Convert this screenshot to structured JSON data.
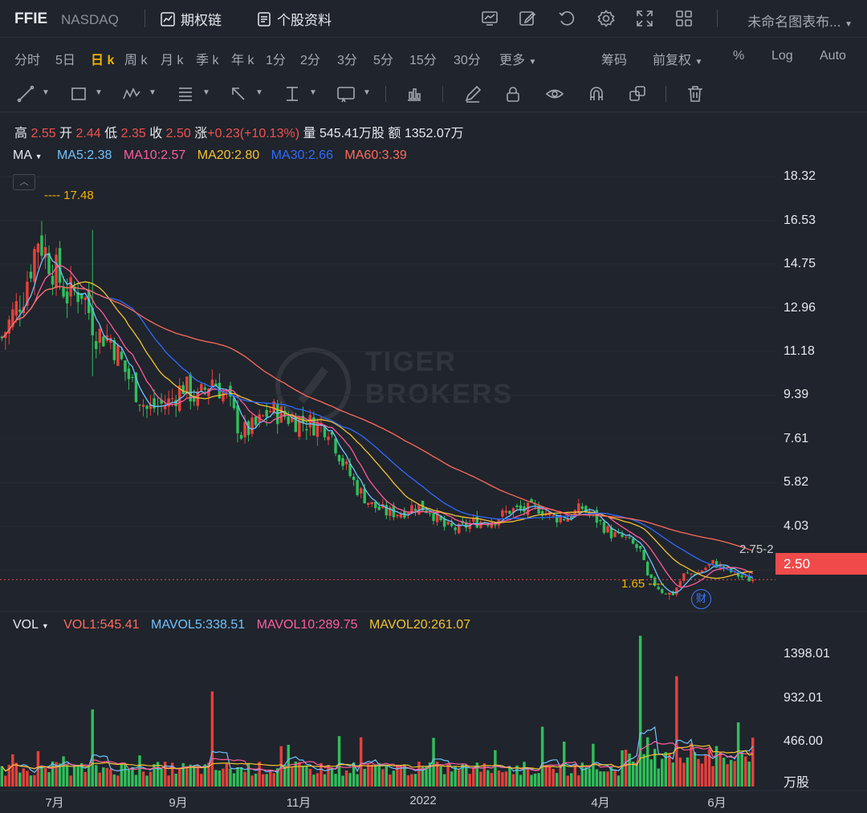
{
  "header": {
    "ticker": "FFIE",
    "exchange": "NASDAQ",
    "options_chain": "期权链",
    "stock_profile": "个股资料",
    "layout_name": "未命名图表布..."
  },
  "periods": [
    "分时",
    "5日",
    "日 k",
    "周 k",
    "月 k",
    "季 k",
    "年 k",
    "1分",
    "2分",
    "3分",
    "5分",
    "15分",
    "30分",
    "更多"
  ],
  "active_period": "日 k",
  "right_options": {
    "chips": "筹码",
    "adjust": "前复权",
    "percent": "%",
    "log": "Log",
    "auto": "Auto"
  },
  "info": {
    "high_label": "高",
    "high": "2.55",
    "open_label": "开",
    "open": "2.44",
    "low_label": "低",
    "low": "2.35",
    "close_label": "收",
    "close": "2.50",
    "change_label": "涨",
    "change": "+0.23(+10.13%)",
    "volume_label": "量",
    "volume": "545.41万股",
    "amount_label": "额",
    "amount": "1352.07万"
  },
  "ma_legend": {
    "name": "MA",
    "items": [
      {
        "text": "MA5:2.38",
        "color": "#6fc3ff"
      },
      {
        "text": "MA10:2.57",
        "color": "#ff5c9d"
      },
      {
        "text": "MA20:2.80",
        "color": "#f2c230"
      },
      {
        "text": "MA30:2.66",
        "color": "#2f6bff"
      },
      {
        "text": "MA60:3.39",
        "color": "#ff6b5c"
      }
    ]
  },
  "vol_legend": {
    "name": "VOL",
    "items": [
      {
        "text": "VOL1:545.41",
        "color": "#ff6b5c"
      },
      {
        "text": "MAVOL5:338.51",
        "color": "#6fc3ff"
      },
      {
        "text": "MAVOL10:289.75",
        "color": "#ff5c9d"
      },
      {
        "text": "MAVOL20:261.07",
        "color": "#f2c230"
      }
    ]
  },
  "annotations": {
    "max_label": "17.48",
    "min_label": "1.65",
    "right_partial": "2.75-2",
    "earnings_icon": "财",
    "last_price": "2.50"
  },
  "watermark": {
    "line1": "TIGER",
    "line2": "BROKERS"
  },
  "chart_data": {
    "type": "candlestick",
    "price_axis": {
      "ticks": [
        "18.32",
        "16.53",
        "14.75",
        "12.96",
        "11.18",
        "9.39",
        "7.61",
        "5.82",
        "4.03",
        "2.50"
      ],
      "min": 1.3,
      "max": 19.5
    },
    "volume_axis": {
      "ticks": [
        "1398.01",
        "932.01",
        "466.00"
      ],
      "unit": "万股"
    },
    "x_ticks": [
      "7月",
      "9月",
      "11月",
      "2022",
      "4月",
      "6月"
    ],
    "colors": {
      "up": "#e8403c",
      "down": "#2fbf5a",
      "ma5": "#6fc3ff",
      "ma10": "#ff5c9d",
      "ma20": "#f2c230",
      "ma30": "#2f6bff",
      "ma60": "#ff6b5c"
    },
    "close_trend": [
      [
        0,
        12.6
      ],
      [
        6,
        14.5
      ],
      [
        10,
        16.8
      ],
      [
        14,
        15.6
      ],
      [
        18,
        14.4
      ],
      [
        22,
        14.6
      ],
      [
        26,
        12.8
      ],
      [
        30,
        12.6
      ],
      [
        34,
        11.2
      ],
      [
        40,
        9.6
      ],
      [
        46,
        9.9
      ],
      [
        50,
        10.6
      ],
      [
        54,
        10.0
      ],
      [
        58,
        10.9
      ],
      [
        62,
        10.1
      ],
      [
        66,
        8.6
      ],
      [
        70,
        8.9
      ],
      [
        74,
        9.6
      ],
      [
        80,
        9.2
      ],
      [
        86,
        9.0
      ],
      [
        90,
        8.9
      ],
      [
        94,
        7.4
      ],
      [
        98,
        6.3
      ],
      [
        102,
        5.6
      ],
      [
        106,
        5.3
      ],
      [
        110,
        5.3
      ],
      [
        114,
        5.6
      ],
      [
        118,
        5.4
      ],
      [
        122,
        4.7
      ],
      [
        126,
        4.6
      ],
      [
        130,
        4.9
      ],
      [
        136,
        5.0
      ],
      [
        140,
        5.4
      ],
      [
        144,
        5.4
      ],
      [
        148,
        5.5
      ],
      [
        152,
        5.1
      ],
      [
        156,
        5.1
      ],
      [
        160,
        5.5
      ],
      [
        164,
        5.0
      ],
      [
        168,
        4.4
      ],
      [
        172,
        4.2
      ],
      [
        176,
        3.7
      ],
      [
        178,
        2.6
      ],
      [
        182,
        2.0
      ],
      [
        185,
        1.9
      ],
      [
        188,
        2.7
      ],
      [
        192,
        2.8
      ],
      [
        196,
        3.2
      ],
      [
        200,
        2.9
      ],
      [
        204,
        2.6
      ],
      [
        206,
        2.5
      ]
    ],
    "events": [
      {
        "bar": 11,
        "high": 17.48
      },
      {
        "bar": 25,
        "high": 17.1,
        "low": 11.0
      },
      {
        "bar": 184,
        "low": 1.65
      }
    ],
    "volume_events": [
      {
        "bar": 25,
        "value": 860
      },
      {
        "bar": 58,
        "value": 1060
      },
      {
        "bar": 176,
        "value": 1680
      },
      {
        "bar": 186,
        "value": 1230
      },
      {
        "bar": 207,
        "value": 545.41
      }
    ],
    "n_bars": 208
  }
}
